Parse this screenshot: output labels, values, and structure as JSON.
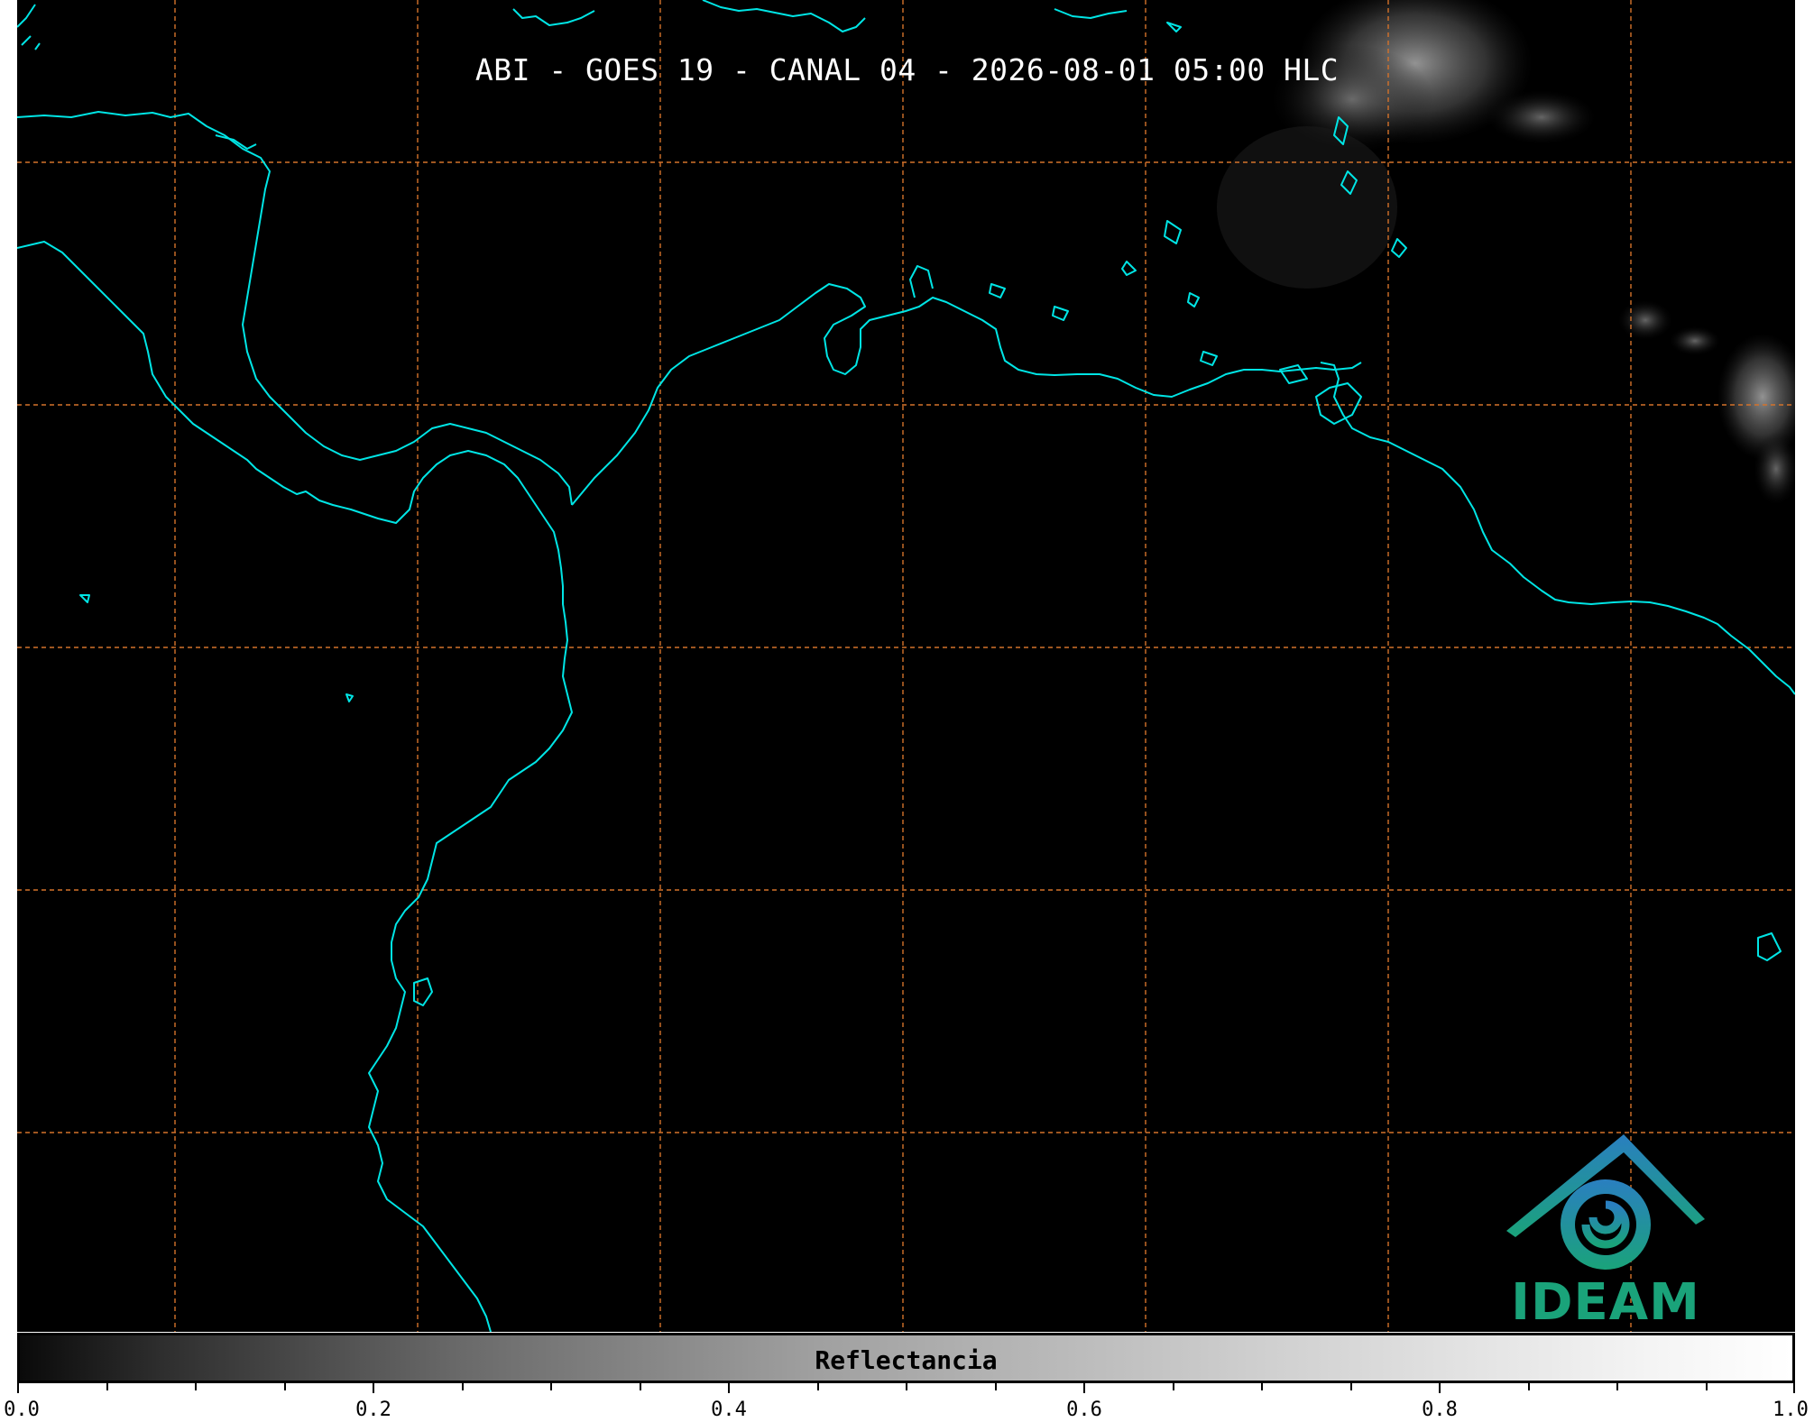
{
  "title": "ABI - GOES 19 - CANAL 04 - 2026-08-01 05:00 HLC",
  "colorbar": {
    "label": "Reflectancia",
    "ticks": [
      "0.0",
      "0.2",
      "0.4",
      "0.6",
      "0.8",
      "1.0"
    ],
    "range": [
      0.0,
      1.0
    ],
    "colormap": "grayscale"
  },
  "logo": {
    "text": "IDEAM"
  },
  "colors": {
    "background": "#000000",
    "coastline": "#00e5e5",
    "gridlines": "#d4722a",
    "logo_green": "#1aa37a",
    "logo_blue": "#2a7fc0"
  },
  "map": {
    "gridlines": "dashed",
    "coastlines": true,
    "cloud_features": [
      "upper-right cloud cluster",
      "right-edge cloud band"
    ]
  }
}
